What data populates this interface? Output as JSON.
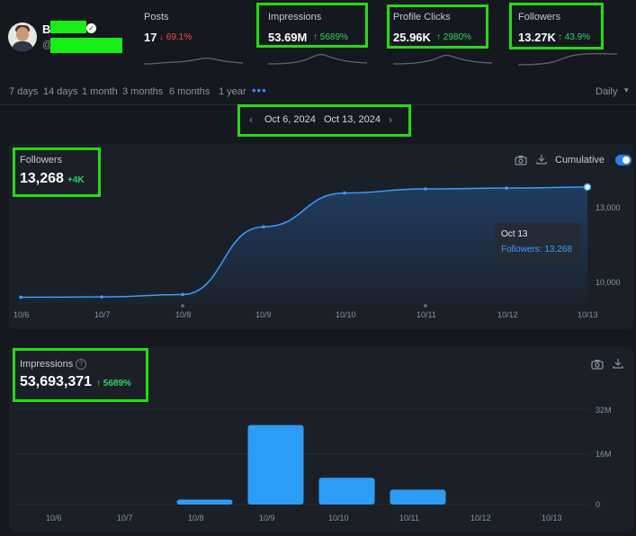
{
  "profile": {
    "name_initial": "B",
    "handle_prefix": "@"
  },
  "stats": [
    {
      "label": "Posts",
      "value": "17",
      "change": "69.1%",
      "direction": "down"
    },
    {
      "label": "Impressions",
      "value": "53.69M",
      "change": "5689%",
      "direction": "up"
    },
    {
      "label": "Profile Clicks",
      "value": "25.96K",
      "change": "2980%",
      "direction": "up"
    },
    {
      "label": "Followers",
      "value": "13.27K",
      "change": "43.9%",
      "direction": "up"
    }
  ],
  "ranges": [
    "7 days",
    "14 days",
    "1 month",
    "3 months",
    "6 months",
    "1 year"
  ],
  "more_label": "•••",
  "interval": {
    "selected": "Daily"
  },
  "date_range": {
    "start": "Oct 6, 2024",
    "end": "Oct 13, 2024"
  },
  "followers_panel": {
    "title": "Followers",
    "total": "13,268",
    "change": "+4K",
    "cumulative_label": "Cumulative",
    "cumulative_on": true,
    "tooltip": {
      "date": "Oct 13",
      "text": "Followers: 13,268"
    }
  },
  "impressions_panel": {
    "title": "Impressions",
    "total": "53,693,371",
    "change": "5689%"
  },
  "colors": {
    "accent": "#3b82f6",
    "positive": "#2fd16b",
    "negative": "#ef4a4a",
    "highlight": "#22dd11"
  },
  "chart_data": [
    {
      "type": "area",
      "title": "Followers",
      "categories": [
        "10/6",
        "10/7",
        "10/8",
        "10/9",
        "10/10",
        "10/11",
        "10/12",
        "10/13"
      ],
      "series": [
        {
          "name": "Followers",
          "values": [
            9200,
            9210,
            9300,
            11800,
            13050,
            13200,
            13230,
            13268
          ]
        }
      ],
      "y_ticks": [
        "10,000",
        "13,000"
      ],
      "ylim": [
        8950,
        13700
      ]
    },
    {
      "type": "bar",
      "title": "Impressions",
      "categories": [
        "10/6",
        "10/7",
        "10/8",
        "10/9",
        "10/10",
        "10/11",
        "10/12",
        "10/13"
      ],
      "series": [
        {
          "name": "Impressions",
          "values": [
            0,
            0,
            2500000,
            40000000,
            13500000,
            7500000,
            0,
            0
          ]
        }
      ],
      "y_ticks": [
        "0",
        "16M",
        "32M"
      ],
      "ylim": [
        0,
        48000000
      ]
    }
  ]
}
